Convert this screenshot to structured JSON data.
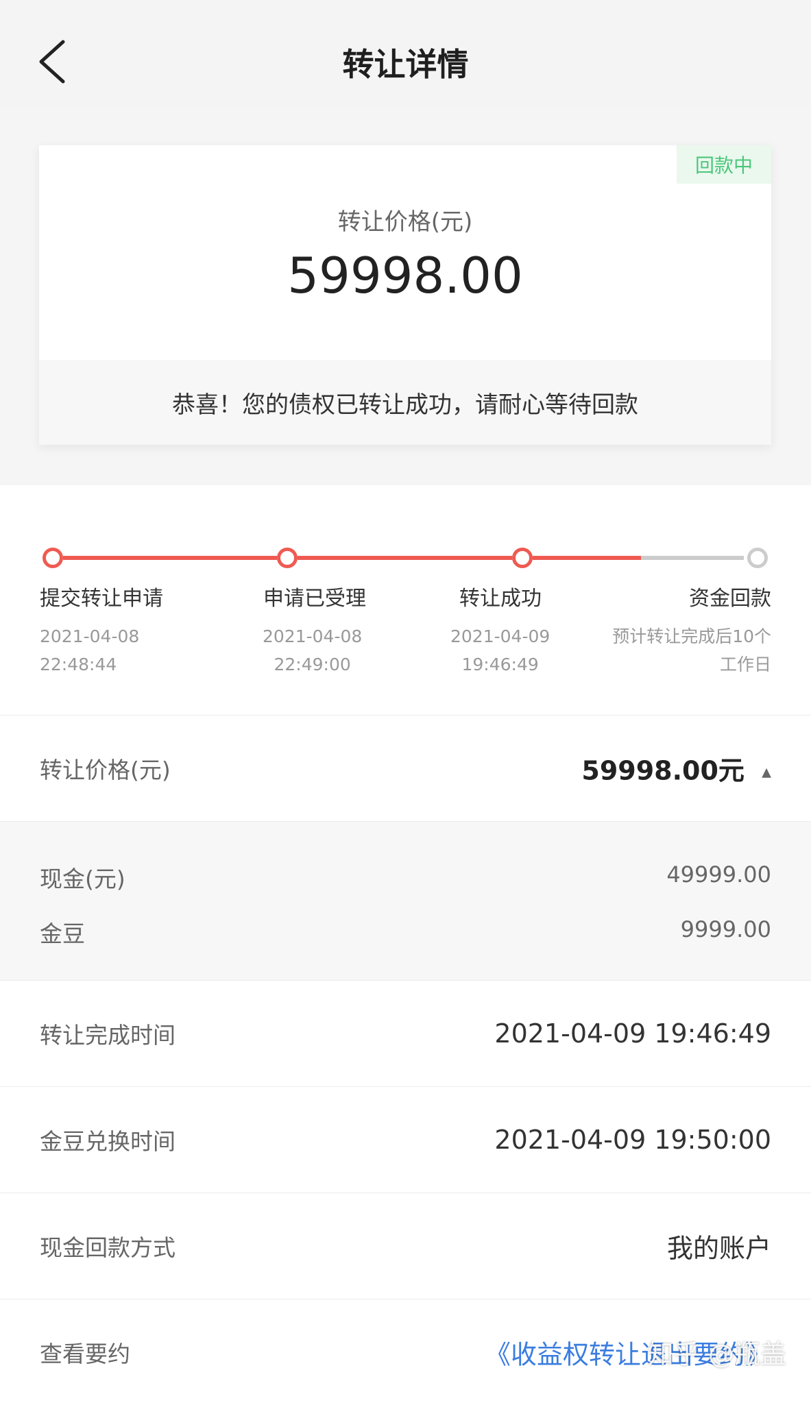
{
  "header": {
    "title": "转让详情"
  },
  "summary": {
    "badge": "回款中",
    "label": "转让价格(元)",
    "amount": "59998.00",
    "message": "恭喜！您的债权已转让成功，请耐心等待回款"
  },
  "progress": {
    "steps": [
      {
        "name": "提交转让申请",
        "line1": "2021-04-08",
        "line2": "22:48:44",
        "done": true
      },
      {
        "name": "申请已受理",
        "line1": "2021-04-08",
        "line2": "22:49:00",
        "done": true
      },
      {
        "name": "转让成功",
        "line1": "2021-04-09",
        "line2": "19:46:49",
        "done": true
      },
      {
        "name": "资金回款",
        "line1": "预计转让完成后10个",
        "line2": "工作日",
        "done": false
      }
    ],
    "colors": {
      "active": "#ee5a52",
      "inactive": "#cccccc"
    }
  },
  "details": {
    "price": {
      "label": "转让价格(元)",
      "value": "59998.00元",
      "caret": "▲"
    },
    "cash": {
      "label": "现金(元)",
      "value": "49999.00"
    },
    "beans": {
      "label": "金豆",
      "value": "9999.00"
    },
    "complete_time": {
      "label": "转让完成时间",
      "value": "2021-04-09 19:46:49"
    },
    "exchange_time": {
      "label": "金豆兑换时间",
      "value": "2021-04-09 19:50:00"
    },
    "refund_method": {
      "label": "现金回款方式",
      "value": "我的账户"
    },
    "contract": {
      "label": "查看要约",
      "value": "《收益权转让退出要约》"
    }
  },
  "watermark": "知乎 @瓶盖"
}
